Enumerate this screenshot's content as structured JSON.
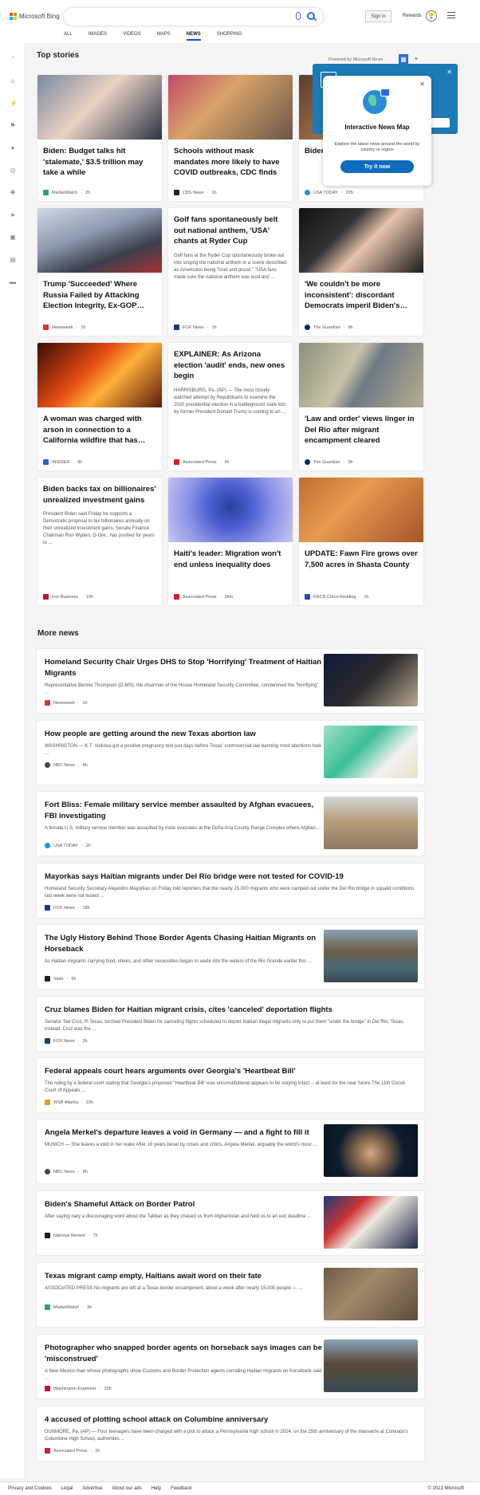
{
  "header": {
    "brand": "Microsoft Bing",
    "signin_label": "Sign in",
    "rewards_label": "Rewards",
    "nav": [
      "ALL",
      "IMAGES",
      "VIDEOS",
      "MAPS",
      "NEWS",
      "SHOPPING"
    ],
    "active_nav": "NEWS"
  },
  "top_stories": {
    "title": "Top stories",
    "powered": "Powered by Microsoft News"
  },
  "popup": {
    "title": "Interactive News Map",
    "desc": "Explore the latest news around the world by country or region",
    "button": "Try it now"
  },
  "cards": [
    {
      "title": "Biden: Budget talks hit 'stalemate,' $3.5 trillion may take a while",
      "source": "MarketWatch",
      "time": "2h",
      "snippet": ""
    },
    {
      "title": "Schools without mask mandates more likely to have COVID outbreaks, CDC finds",
      "source": "CBS News",
      "time": "1h",
      "snippet": ""
    },
    {
      "title": "Biden endo Afric",
      "source": "USA TODAY",
      "time": "22h",
      "snippet": ""
    },
    {
      "title": "Trump 'Succeeded' Where Russia Failed by Attacking Election Integrity, Ex-GOP…",
      "source": "Newsweek",
      "time": "1h",
      "snippet": ""
    },
    {
      "title": "Golf fans spontaneously belt out national anthem, 'USA' chants at Ryder Cup",
      "source": "FOX News",
      "time": "1h",
      "snippet": "Golf fans at the Ryder Cup spontaneously broke out into singing the national anthem in a scene described as Americans being \"loud and proud.\" \"USA fans made sure the national anthem was loud and ..."
    },
    {
      "title": "'We couldn't be more inconsistent': discordant Democrats imperil Biden's…",
      "source": "The Guardian",
      "time": "9h",
      "snippet": ""
    },
    {
      "title": "A woman was charged with arson in connection to a California wildfire that has…",
      "source": "INSIDER",
      "time": "9h",
      "snippet": ""
    },
    {
      "title": "EXPLAINER: As Arizona election 'audit' ends, new ones begin",
      "source": "Associated Press",
      "time": "1h",
      "snippet": "HARRISBURG, Pa. (AP) — The most closely watched attempt by Republicans to examine the 2020 presidential election in a battleground state lost by former President Donald Trump is coming to an ..."
    },
    {
      "title": "'Law and order' views linger in Del Rio after migrant encampment cleared",
      "source": "The Guardian",
      "time": "3h",
      "snippet": ""
    },
    {
      "title": "Biden backs tax on billionaires' unrealized investment gains",
      "source": "Fox Business",
      "time": "19h",
      "snippet": "President Biden said Friday he supports a Democratic proposal to tax billionaires annually on their unrealized investment gains. Senate Finance Chairman Ron Wyden, D-Ore., has pushed for years to ..."
    },
    {
      "title": "Haiti's leader: Migration won't end unless inequality does",
      "source": "Associated Press",
      "time": "38m",
      "snippet": ""
    },
    {
      "title": "UPDATE: Fawn Fire grows over 7,500 acres in Shasta County",
      "source": "KRCR Chico-Redding",
      "time": "1h",
      "snippet": ""
    }
  ],
  "more_news": {
    "title": "More news",
    "items": [
      {
        "title": "Homeland Security Chair Urges DHS to Stop 'Horrifying' Treatment of Haitian Migrants",
        "snippet": "Representative Bennie Thompson (D-MS), the chairman of the House Homeland Security Committee, condemned the \"horrifying\" ...",
        "source": "Newsweek",
        "time": "1h"
      },
      {
        "title": "How people are getting around the new Texas abortion law",
        "snippet": "WASHINGTON — K.T. Volkova got a positive pregnancy test just days before Texas' controversial law banning most abortions took ...",
        "source": "NBC News",
        "time": "8h"
      },
      {
        "title": "Fort Bliss: Female military service member assaulted by Afghan evacuees, FBI investigating",
        "snippet": "A female U.S. military service member was assaulted by male evacuees at the Doña Ana County Range Complex where Afghan ...",
        "source": "USA TODAY",
        "time": "2h"
      },
      {
        "title": "Mayorkas says Haitian migrants under Del Rio bridge were not tested for COVID-19",
        "snippet": "Homeland Security Secretary Alejandro Mayorkas on Friday told reporters that the nearly 15,000 migrants who were camped out under the Del Rio bridge in squalid conditions last week were not tested ...",
        "source": "FOX News",
        "time": "18h"
      },
      {
        "title": "The Ugly History Behind Those Border Agents Chasing Haitian Migrants on Horseback",
        "snippet": "As Haitian migrants carrying food, shoes, and other necessities began to wade into the waters of the Rio Grande earlier this ...",
        "source": "Slate",
        "time": "6h"
      },
      {
        "title": "Cruz blames Biden for Haitian migrant crisis, cites 'canceled' deportation flights",
        "snippet": "Senator Ted Cruz, R-Texas, torched President Biden for canceling flights scheduled to deport Haitian illegal migrants only to put them \"under the bridge\" in Del Rio, Texas, instead. Cruz was the ...",
        "source": "FOX News",
        "time": "2h"
      },
      {
        "title": "Federal appeals court hears arguments over Georgia's 'Heartbeat Bill'",
        "snippet": "The ruling by a federal court stating that Georgia's proposed \"Heartbeat Bill\" was unconstitutional appears to be staying intact -- at least for the near future.The 11th Circuit Court of Appeals ...",
        "source": "WSB Atlanta",
        "time": "19h"
      },
      {
        "title": "Angela Merkel's departure leaves a void in Germany — and a fight to fill it",
        "snippet": "MUNICH — She leaves a void in her wake After 16 years beset by crises and critics, Angela Merkel, arguably the world's most ...",
        "source": "NBC News",
        "time": "8h"
      },
      {
        "title": "Biden's Shameful Attack on Border Patrol",
        "snippet": "After saying nary a discouraging word about the Taliban as they chased us from Afghanistan and held us to an exit deadline ...",
        "source": "National Review",
        "time": "7h"
      },
      {
        "title": "Texas migrant camp empty, Haitians await word on their fate",
        "snippet": "ASSOCIATED PRESS No migrants are left at a Texas border encampment, about a week after nearly 15,000 people — ...",
        "source": "MarketWatch",
        "time": "3h"
      },
      {
        "title": "Photographer who snapped border agents on horseback says images can be 'misconstrued'",
        "snippet": "A New Mexico man whose photographs show Customs and Border Protection agents corralling Haitian migrants on horseback said ...",
        "source": "Washington Examiner",
        "time": "23h"
      },
      {
        "title": "4 accused of plotting school attack on Columbine anniversary",
        "snippet": "DUNMORE, Pa. (AP) — Four teenagers have been charged with a plot to attack a Pennsylvania high school in 2024, on the 25th anniversary of the massacre at Colorado's Columbine High School, authorities ...",
        "source": "Associated Press",
        "time": "2h"
      }
    ]
  },
  "footer": {
    "links": [
      "Privacy and Cookies",
      "Legal",
      "Advertise",
      "About our ads",
      "Help",
      "Feedback"
    ],
    "copyright": "© 2021 Microsoft"
  }
}
